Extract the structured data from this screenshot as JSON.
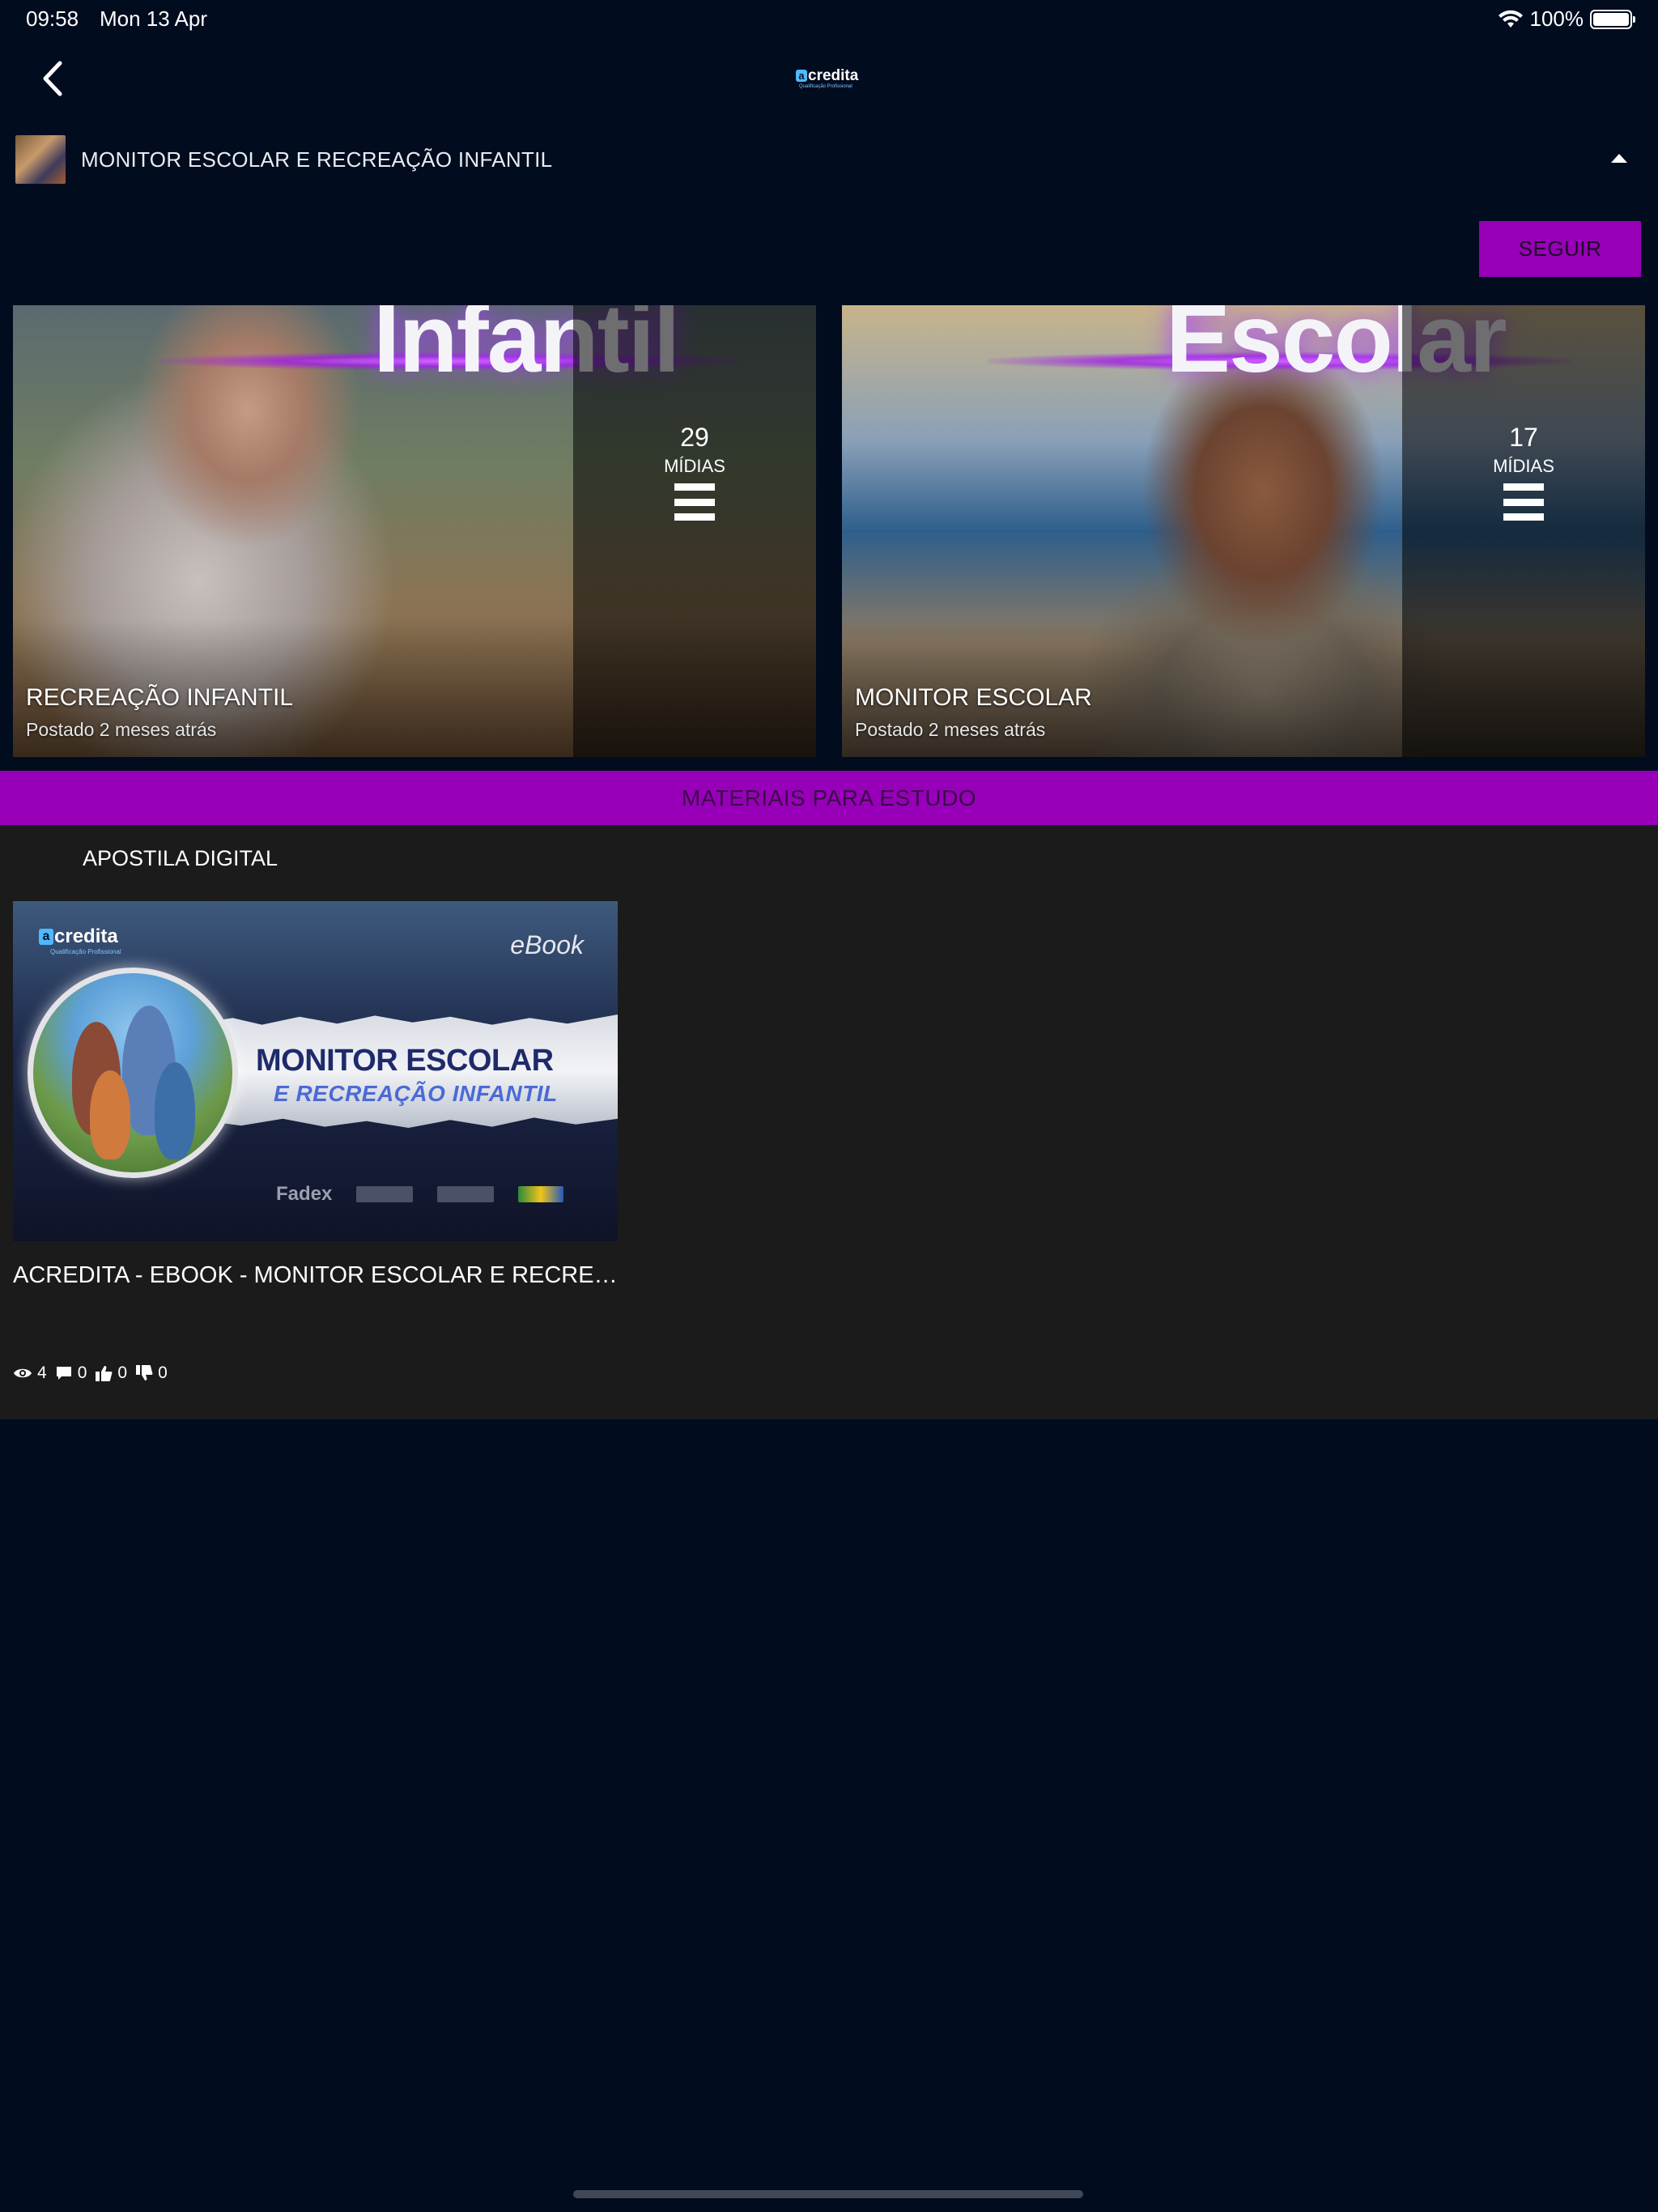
{
  "status_bar": {
    "time": "09:58",
    "date": "Mon 13 Apr",
    "battery": "100%"
  },
  "nav": {
    "logo_text": "credita",
    "logo_subtitle": "Qualificação Profissional"
  },
  "channel": {
    "title": "MONITOR ESCOLAR E RECREAÇÃO INFANTIL"
  },
  "follow_label": "SEGUIR",
  "playlists": [
    {
      "title": "RECREAÇÃO INFANTIL",
      "posted": "Postado 2 meses atrás",
      "media_count": "29",
      "media_label": "MÍDIAS",
      "cover_word": "Infantil"
    },
    {
      "title": "MONITOR ESCOLAR",
      "posted": "Postado 2 meses atrás",
      "media_count": "17",
      "media_label": "MÍDIAS",
      "cover_word": "Escolar"
    }
  ],
  "materials": {
    "bar_label": "MATERIAIS PARA ESTUDO",
    "section_title": "APOSTILA DIGITAL",
    "item": {
      "title": "ACREDITA - EBOOK - MONITOR ESCOLAR E RECREAÇÃO INFANTIL",
      "thumb_logo": "credita",
      "thumb_logo_sub": "Qualificação Profissional",
      "thumb_label": "eBook",
      "thumb_headline": "MONITOR ESCOLAR",
      "thumb_subheadline": "E RECREAÇÃO INFANTIL",
      "thumb_partner": "Fadex",
      "stats": {
        "views": "4",
        "comments": "0",
        "likes": "0",
        "dislikes": "0"
      }
    }
  },
  "colors": {
    "background": "#020c1f",
    "accent": "#9700b8",
    "panel": "#1b1b1c"
  }
}
